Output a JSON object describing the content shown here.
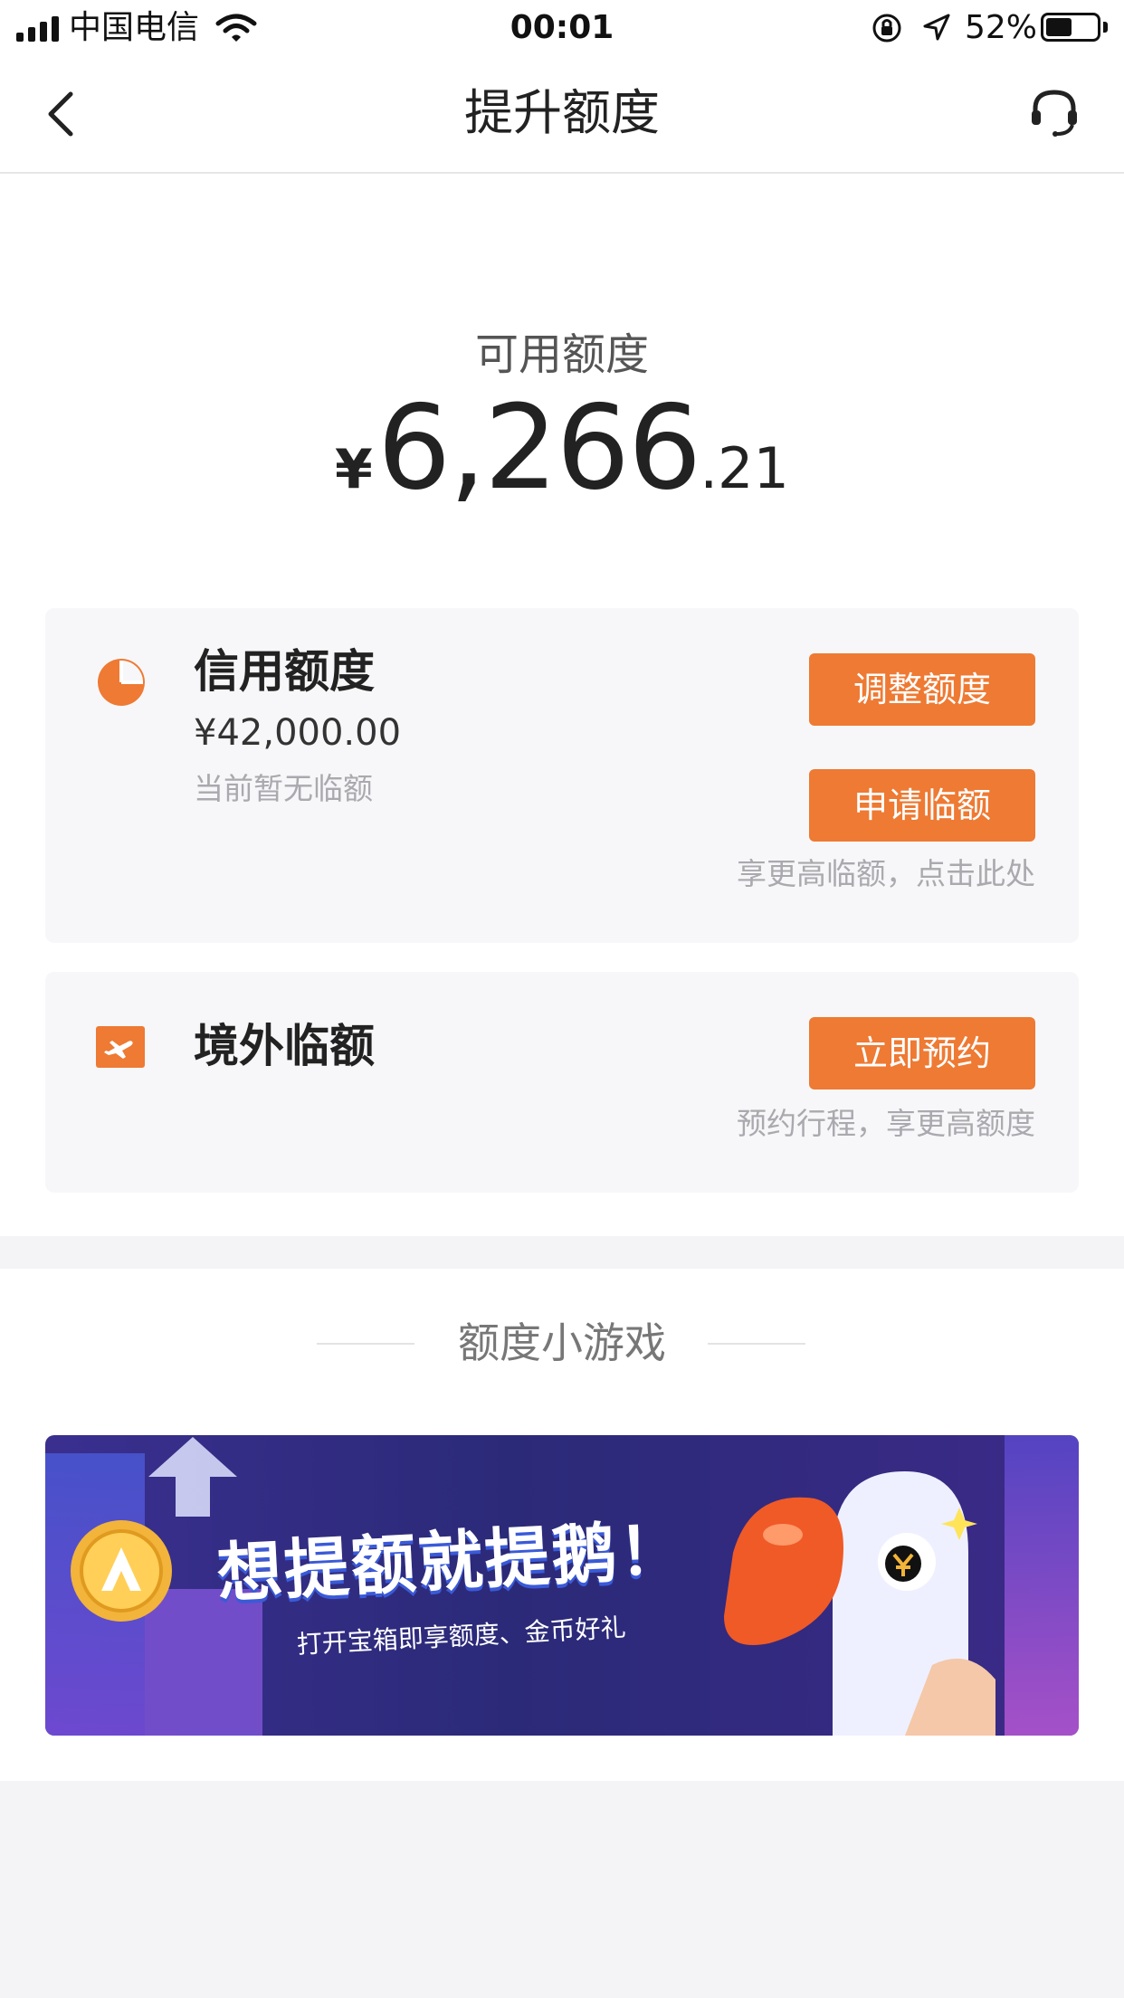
{
  "status_bar": {
    "carrier": "中国电信",
    "time": "00:01",
    "battery": "52%",
    "battery_level": 0.52
  },
  "nav": {
    "title": "提升额度",
    "back_icon": "chevron-left-icon",
    "service_icon": "headset-icon"
  },
  "available": {
    "label": "可用额度",
    "currency": "¥",
    "amount_int": "6,266",
    "amount_dec": ".21"
  },
  "credit_card": {
    "title": "信用额度",
    "amount": "¥42,000.00",
    "sub": "当前暂无临额",
    "adjust_label": "调整额度",
    "apply_label": "申请临额",
    "hint": "享更高临额，点击此处",
    "icon": "pie-chart-icon"
  },
  "overseas_card": {
    "title": "境外临额",
    "reserve_label": "立即预约",
    "hint": "预约行程，享更高额度",
    "icon": "airplane-icon"
  },
  "games": {
    "section_title": "额度小游戏",
    "banner_title": "想提额就提鹅！",
    "banner_subtitle": "打开宝箱即享额度、金币好礼"
  },
  "colors": {
    "accent": "#ee7a33",
    "banner_bg": "#2a2a7a"
  }
}
